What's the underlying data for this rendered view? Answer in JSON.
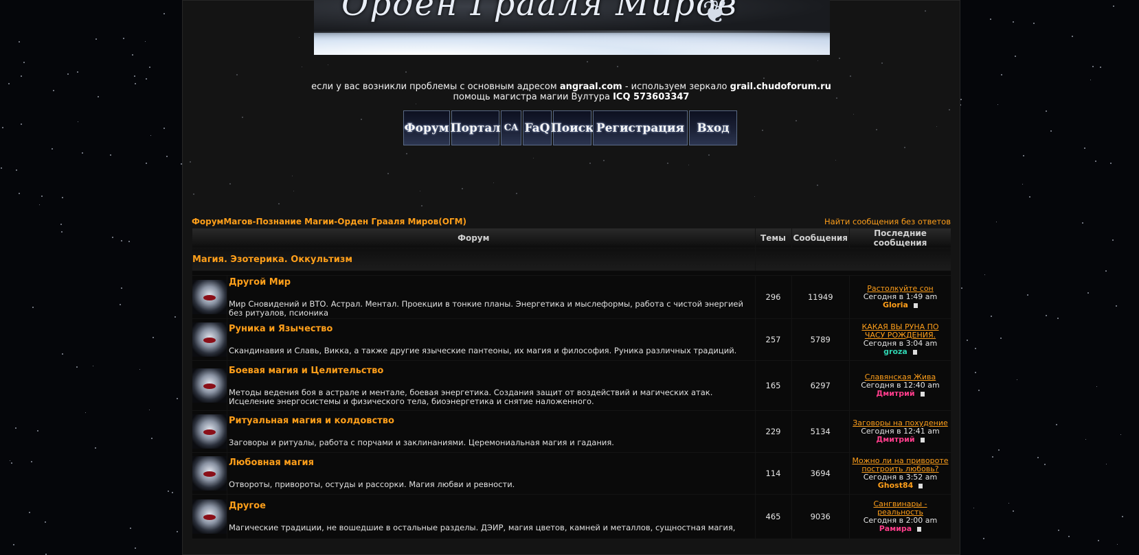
{
  "banner": {
    "title": "Орден Грааля Миров"
  },
  "notice": {
    "line1_prefix": "если у вас возникли проблемы с основным адресом",
    "main_domain": "angraal.com",
    "line1_mid": "- используем зеркало",
    "mirror_domain": "grail.chudoforum.ru",
    "line2_prefix": "помощь магистра магии Вултура",
    "icq": "ICQ 573603347"
  },
  "nav": {
    "forum": "Форум",
    "portal": "Портал",
    "ca": "CA",
    "faq": "FaQ",
    "search": "Поиск",
    "register": "Регистрация",
    "login": "Вход"
  },
  "breadcrumb": "ФорумМагов-Познание Магии-Орден Грааля Миров(ОГМ)",
  "unanswered_link": "Найти сообщения без ответов",
  "table": {
    "headers": {
      "forum": "Форум",
      "topics": "Темы",
      "posts": "Сообщения",
      "last": "Последние сообщения"
    },
    "category": "Магия. Эзотерика. Оккультизм",
    "rows": [
      {
        "name": "Другой Мир",
        "desc": "Мир Сновидений и ВТО. Астрал. Ментал. Проекции в тонкие планы. Энергетика и мыслеформы, работа с чистой энергией без ритуалов, псионика",
        "topics": "296",
        "posts": "11949",
        "last_topic": "Растолкуйте сон",
        "last_time": "Сегодня в 1:49 am",
        "last_user": "Gloria",
        "user_color": "#ff9f1a"
      },
      {
        "name": "Руника и Язычество",
        "desc": "Скандинавия и Славь, Викка, а также другие языческие пантеоны, их магия и философия. Руника различных традиций.",
        "topics": "257",
        "posts": "5789",
        "last_topic": "КАКАЯ ВЫ РУНА ПО ЧАСУ РОЖДЕНИЯ.",
        "last_time": "Сегодня в 3:04 am",
        "last_user": "groza",
        "user_color": "#2fd3b0"
      },
      {
        "name": "Боевая магия и Целительство",
        "desc": "Методы ведения боя в астрале и ментале, боевая энергетика. Создания защит от воздействий и магических атак. Исцеление энергосистемы и физического тела, биоэнергетика и снятие наложенного.",
        "topics": "165",
        "posts": "6297",
        "last_topic": "Славянская Жива",
        "last_time": "Сегодня в 12:40 am",
        "last_user": "Дмитрий",
        "user_color": "#ff3d8b"
      },
      {
        "name": "Ритуальная магия и колдовство",
        "desc": "Заговоры и ритуалы, работа с порчами и заклинаниями. Церемониальная магия и гадания.",
        "topics": "229",
        "posts": "5134",
        "last_topic": "Заговоры на похудение",
        "last_time": "Сегодня в 12:41 am",
        "last_user": "Дмитрий",
        "user_color": "#ff3d8b"
      },
      {
        "name": "Любовная магия",
        "desc": "Отвороты, привороты, остуды и рассорки. Магия любви и ревности.",
        "topics": "114",
        "posts": "3694",
        "last_topic": "Можно ли на привороте построить любовь?",
        "last_time": "Сегодня в 3:52 am",
        "last_user": "Ghost84",
        "user_color": "#ff9f1a"
      },
      {
        "name": "Другое",
        "desc": "Магические традиции, не вошедшие в остальные разделы. ДЭИР, магия цветов, камней и металлов, сущностная магия,",
        "topics": "465",
        "posts": "9036",
        "last_topic": "Сангвинары - реальность",
        "last_time": "Сегодня в 2:00 am",
        "last_user": "Рамира",
        "user_color": "#ff3d8b"
      }
    ]
  }
}
